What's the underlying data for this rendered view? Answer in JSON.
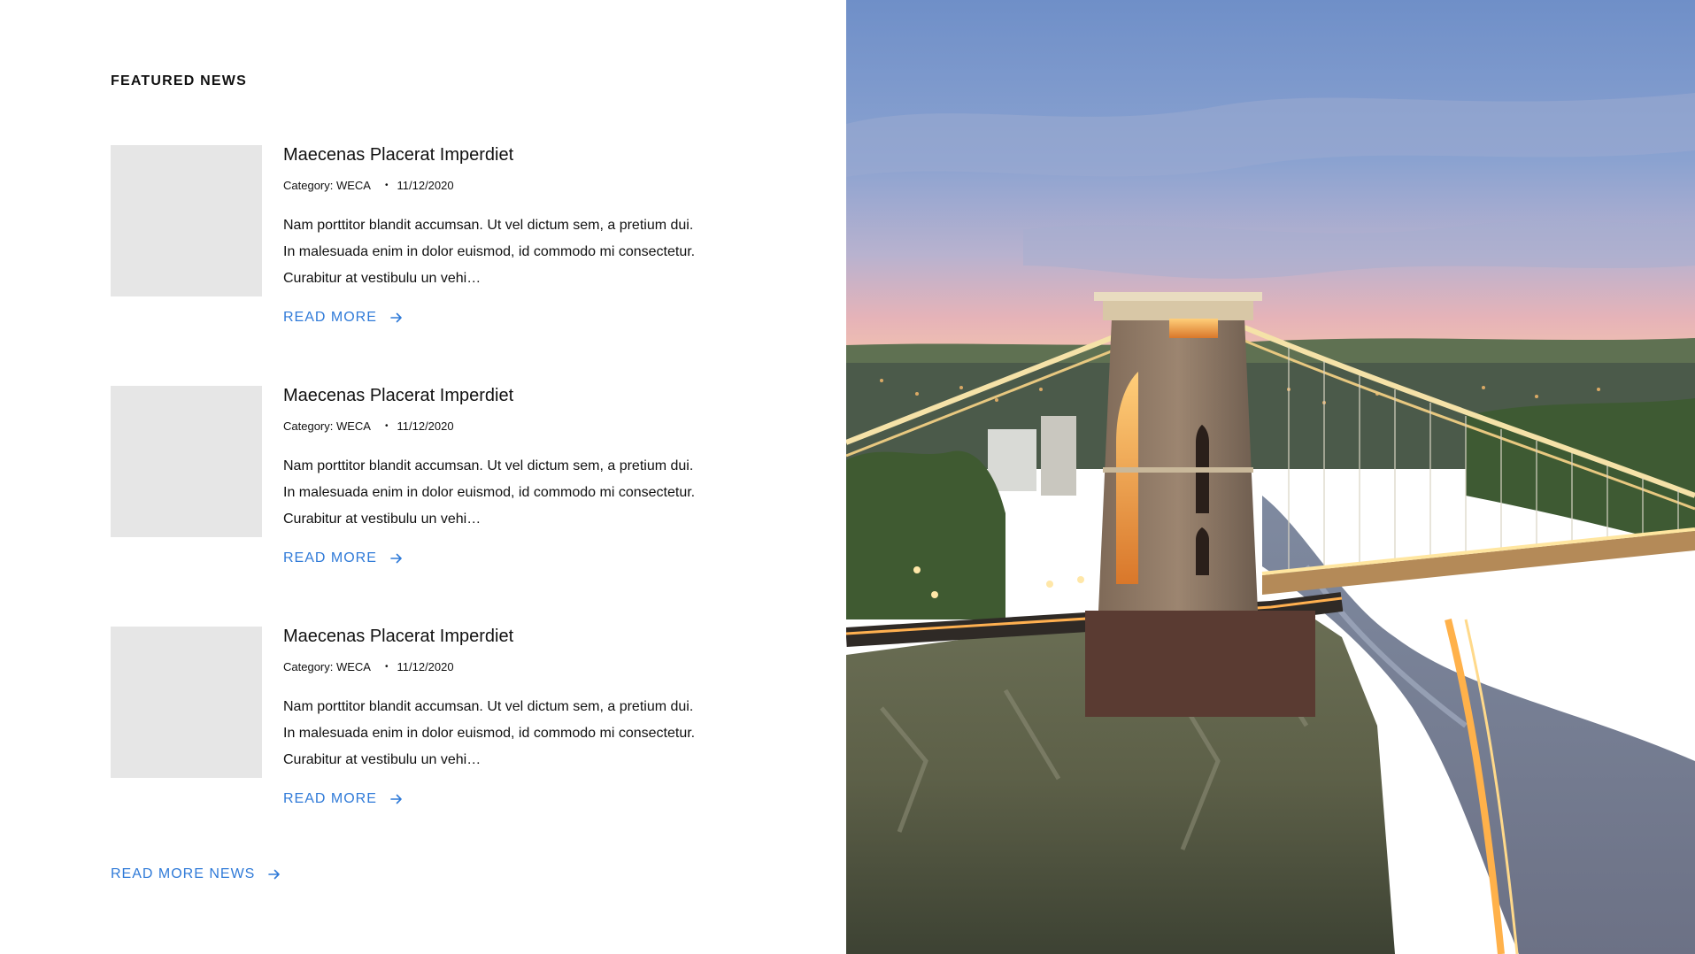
{
  "featured": {
    "title": "FEATURED NEWS",
    "items": [
      {
        "title": "Maecenas Placerat Imperdiet",
        "category": "Category: WECA",
        "date": "11/12/2020",
        "excerpt": "Nam porttitor blandit accumsan. Ut vel dictum sem, a pretium dui. In malesuada enim in dolor euismod, id commodo mi consectetur. Curabitur at vestibulu un vehi…",
        "read_more": "READ MORE"
      },
      {
        "title": "Maecenas Placerat Imperdiet",
        "category": "Category: WECA",
        "date": "11/12/2020",
        "excerpt": "Nam porttitor blandit accumsan. Ut vel dictum sem, a pretium dui. In malesuada enim in dolor euismod, id commodo mi consectetur. Curabitur at vestibulu un vehi…",
        "read_more": "READ MORE"
      },
      {
        "title": "Maecenas Placerat Imperdiet",
        "category": "Category: WECA",
        "date": "11/12/2020",
        "excerpt": "Nam porttitor blandit accumsan. Ut vel dictum sem, a pretium dui. In malesuada enim in dolor euismod, id commodo mi consectetur. Curabitur at vestibulu un vehi…",
        "read_more": "READ MORE"
      }
    ],
    "more_news": "READ MORE NEWS",
    "dot": "•"
  },
  "colors": {
    "link": "#2f7ad8",
    "thumb": "#e6e6e6"
  },
  "icons": {
    "arrow": "arrow-right-icon"
  }
}
